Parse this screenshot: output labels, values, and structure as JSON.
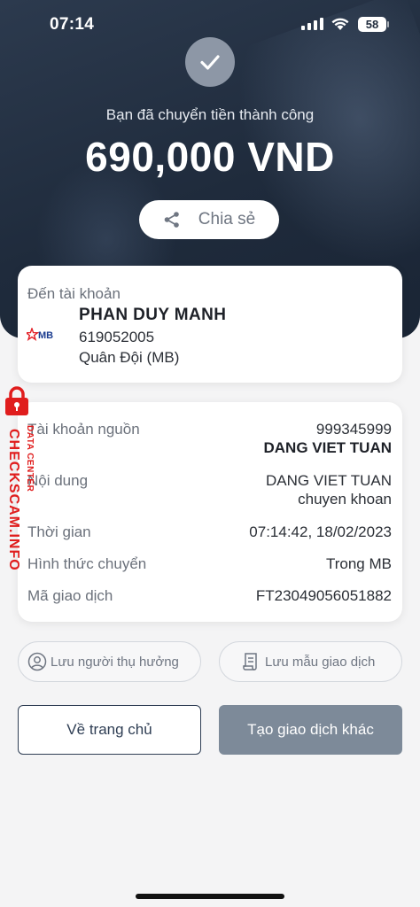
{
  "status_bar": {
    "time": "07:14",
    "battery": "58"
  },
  "hero": {
    "success_message": "Bạn đã chuyển tiền thành công",
    "amount": "690,000 VND",
    "share_label": "Chia sẻ"
  },
  "destination": {
    "label": "Đến tài khoản",
    "bank_logo_text": "MB",
    "name": "PHAN DUY MANH",
    "account_number": "619052005",
    "bank_name": "Quân Đội (MB)"
  },
  "details": {
    "source_account": {
      "label": "Tài khoản nguồn",
      "number": "999345999",
      "name": "DANG VIET TUAN"
    },
    "content": {
      "label": "Nội dung",
      "line1": "DANG VIET TUAN",
      "line2": "chuyen khoan"
    },
    "time": {
      "label": "Thời gian",
      "value": "07:14:42, 18/02/2023"
    },
    "transfer_type": {
      "label": "Hình thức chuyển",
      "value": "Trong MB"
    },
    "transaction_id": {
      "label": "Mã giao dịch",
      "value": "FT23049056051882"
    }
  },
  "watermark": {
    "main": "CHECKSCAM.INFO",
    "sub": "DATA CENTER"
  },
  "actions": {
    "save_beneficiary": "Lưu người thụ hưởng",
    "save_template": "Lưu mẫu giao dịch",
    "home": "Về trang chủ",
    "new_transaction": "Tạo giao dịch khác"
  },
  "colors": {
    "hero_bg": "#1f2b3c",
    "primary_dark": "#2f3e54",
    "button_disabled": "#7d8a99",
    "watermark_red": "#e01d1d",
    "mb_logo_blue": "#1a3b8f",
    "mb_logo_red": "#e31f26"
  }
}
